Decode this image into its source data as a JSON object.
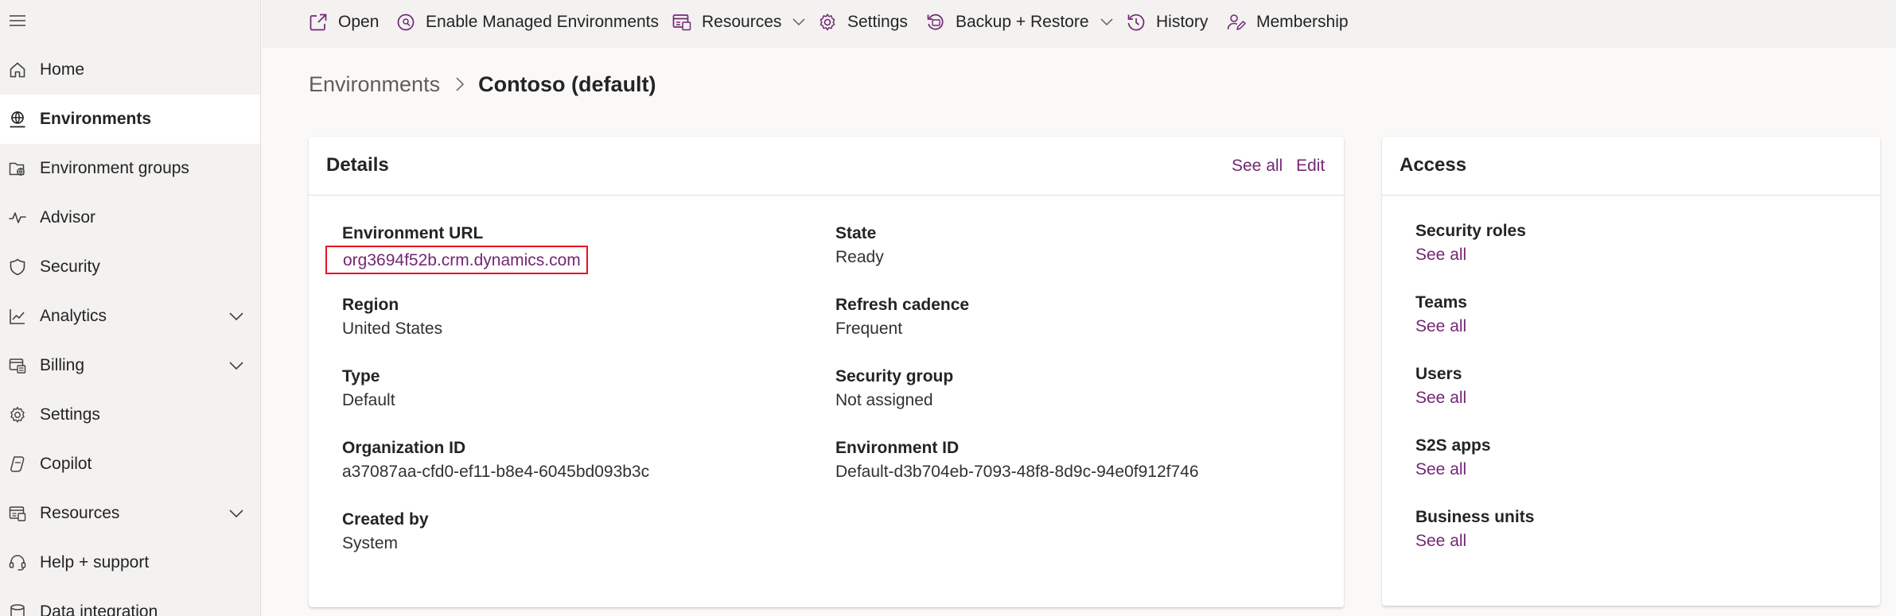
{
  "sidebar": {
    "items": [
      {
        "label": "Home",
        "icon": "home-icon"
      },
      {
        "label": "Environments",
        "icon": "environments-icon",
        "selected": true
      },
      {
        "label": "Environment groups",
        "icon": "environment-groups-icon"
      },
      {
        "label": "Advisor",
        "icon": "advisor-icon"
      },
      {
        "label": "Security",
        "icon": "shield-icon"
      },
      {
        "label": "Analytics",
        "icon": "analytics-icon",
        "expandable": true
      },
      {
        "label": "Billing",
        "icon": "billing-icon",
        "expandable": true
      },
      {
        "label": "Settings",
        "icon": "gear-icon"
      },
      {
        "label": "Copilot",
        "icon": "copilot-icon"
      },
      {
        "label": "Resources",
        "icon": "resources-icon",
        "expandable": true
      },
      {
        "label": "Help + support",
        "icon": "headset-icon"
      },
      {
        "label": "Data integration",
        "icon": "data-integration-icon"
      }
    ]
  },
  "commandbar": {
    "items": [
      {
        "label": "Open",
        "icon": "open-icon"
      },
      {
        "label": "Enable Managed Environments",
        "icon": "managed-environments-icon"
      },
      {
        "label": "Resources",
        "icon": "resources-icon",
        "has_dropdown": true
      },
      {
        "label": "Settings",
        "icon": "gear-icon"
      },
      {
        "label": "Backup + Restore",
        "icon": "backup-restore-icon",
        "has_dropdown": true
      },
      {
        "label": "History",
        "icon": "history-icon"
      },
      {
        "label": "Membership",
        "icon": "membership-icon"
      }
    ]
  },
  "breadcrumb": {
    "parent": "Environments",
    "current": "Contoso (default)"
  },
  "details": {
    "title": "Details",
    "see_all": "See all",
    "edit": "Edit",
    "environment_url": {
      "label": "Environment URL",
      "value": "org3694f52b.crm.dynamics.com"
    },
    "region": {
      "label": "Region",
      "value": "United States"
    },
    "type": {
      "label": "Type",
      "value": "Default"
    },
    "organization_id": {
      "label": "Organization ID",
      "value": "a37087aa-cfd0-ef11-b8e4-6045bd093b3c"
    },
    "created_by": {
      "label": "Created by",
      "value": "System"
    },
    "state": {
      "label": "State",
      "value": "Ready"
    },
    "refresh_cadence": {
      "label": "Refresh cadence",
      "value": "Frequent"
    },
    "security_group": {
      "label": "Security group",
      "value": "Not assigned"
    },
    "environment_id": {
      "label": "Environment ID",
      "value": "Default-d3b704eb-7093-48f8-8d9c-94e0f912f746"
    }
  },
  "access": {
    "title": "Access",
    "items": [
      {
        "label": "Security roles",
        "link": "See all"
      },
      {
        "label": "Teams",
        "link": "See all"
      },
      {
        "label": "Users",
        "link": "See all"
      },
      {
        "label": "S2S apps",
        "link": "See all"
      },
      {
        "label": "Business units",
        "link": "See all"
      }
    ]
  },
  "colors": {
    "accent_link": "#742774",
    "highlight_border": "#e81123",
    "sidebar_bg": "#f3f2f1",
    "page_bg": "#faf9f8"
  }
}
